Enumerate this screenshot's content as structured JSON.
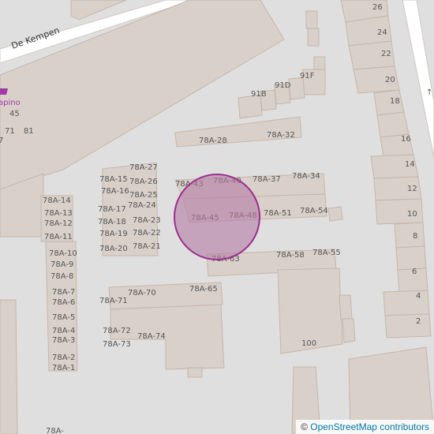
{
  "street": "De Kempen",
  "poi": {
    "name": "apino",
    "number": "45"
  },
  "colors": {
    "marker_fill": "#b47ca6",
    "marker_stroke": "#9b2e8c",
    "poi": "#a03aa6"
  },
  "attribution": {
    "symbol": "©",
    "text": "OpenStreetMap contributors"
  },
  "labels": [
    "26",
    "24",
    "22",
    "20",
    "18",
    "16",
    "14",
    "12",
    "10",
    "8",
    "6",
    "4",
    "2",
    "100",
    "91F",
    "91D",
    "91B",
    "78A-28",
    "78A-32",
    "78A-43",
    "78A-40",
    "78A-37",
    "78A-34",
    "78A-45",
    "78A-48",
    "78A-51",
    "78A-54",
    "78A-63",
    "78A-58",
    "78A-55",
    "78A-27",
    "78A-15",
    "78A-26",
    "78A-16",
    "78A-25",
    "78A-24",
    "78A-17",
    "78A-18",
    "78A-23",
    "78A-19",
    "78A-22",
    "78A-20",
    "78A-21",
    "78A-14",
    "78A-13",
    "78A-12",
    "78A-11",
    "78A-10",
    "78A-9",
    "78A-8",
    "78A-7",
    "78A-6",
    "78A-5",
    "78A-4",
    "78A-3",
    "78A-2",
    "78A-1",
    "78A-",
    "78A-70",
    "78A-65",
    "78A-71",
    "78A-72",
    "78A-74",
    "78A-73",
    "71",
    "81",
    "7"
  ]
}
